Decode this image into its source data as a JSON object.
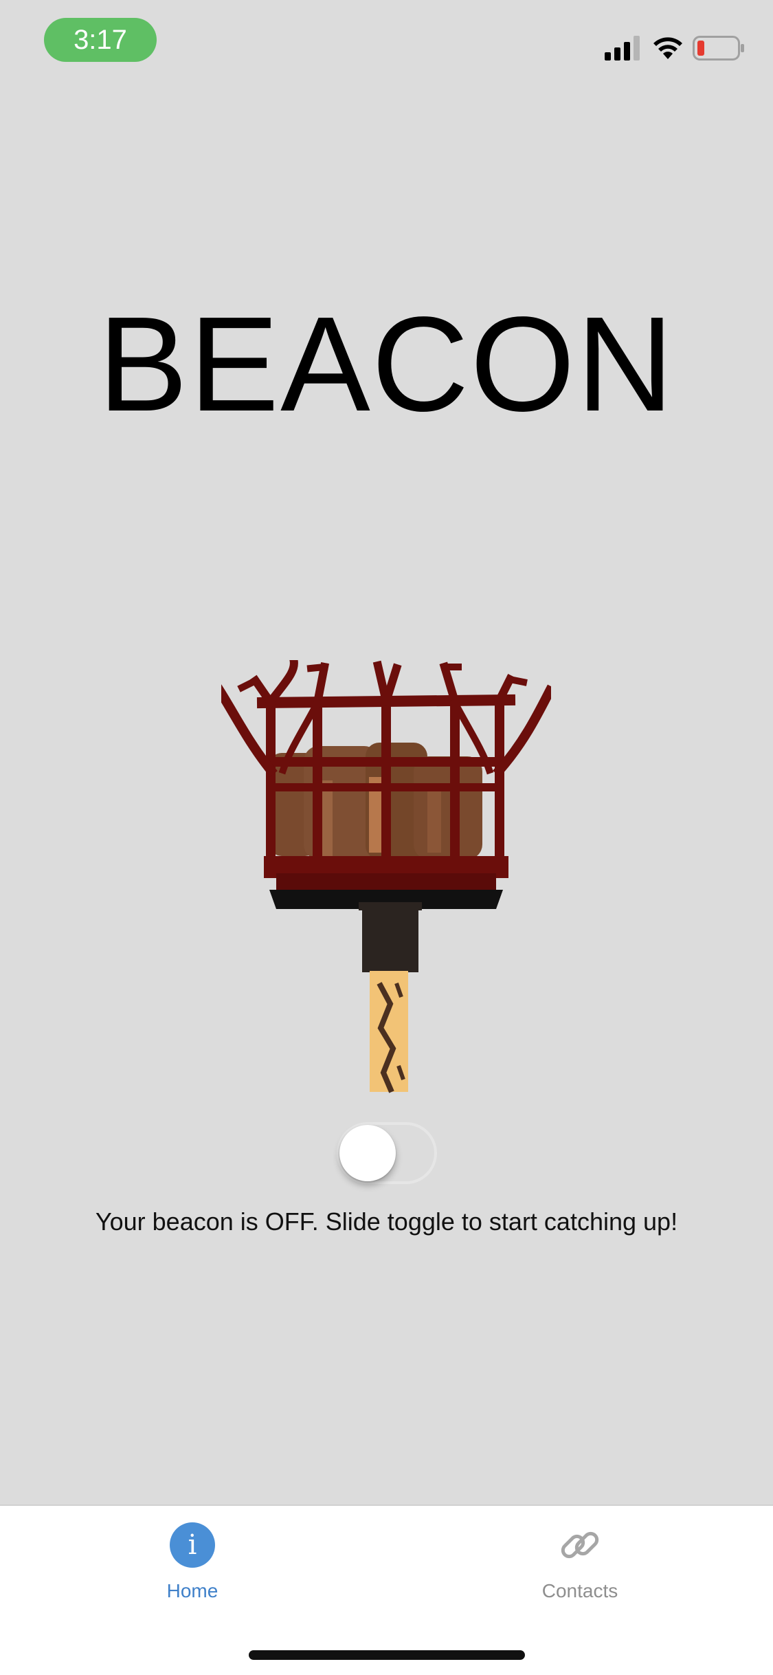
{
  "status_bar": {
    "time": "3:17",
    "icons": [
      "cellular-signal-icon",
      "wifi-icon",
      "battery-low-icon"
    ],
    "battery_level": 0.15,
    "time_pill_color": "#5fbf64"
  },
  "main": {
    "title": "BEACON",
    "illustration": "beacon-brazier-illustration",
    "toggle": {
      "state": "off"
    },
    "status_message": "Your beacon is OFF. Slide toggle to start catching up!"
  },
  "tab_bar": {
    "tabs": [
      {
        "label": "Home",
        "icon": "info-icon",
        "active": true
      },
      {
        "label": "Contacts",
        "icon": "link-icon",
        "active": false
      }
    ],
    "active_color": "#3f80c9",
    "inactive_color": "#8e8e8e"
  },
  "colors": {
    "background": "#dcdcdc",
    "brazier_red": "#6b0e0b",
    "wood_brown": "#7a4a2e"
  }
}
